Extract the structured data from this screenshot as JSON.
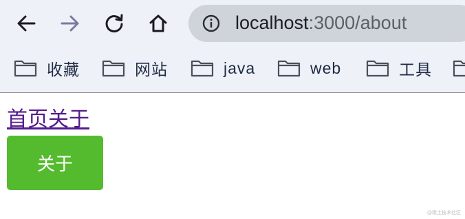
{
  "browser": {
    "url_host": "localhost",
    "url_path": ":3000/about",
    "bookmarks": [
      {
        "label": "收藏",
        "icon": "folder-icon"
      },
      {
        "label": "网站",
        "icon": "folder-icon"
      },
      {
        "label": "java",
        "icon": "folder-icon"
      },
      {
        "label": "web",
        "icon": "folder-icon"
      },
      {
        "label": "工具",
        "icon": "folder-icon"
      },
      {
        "label": "",
        "icon": "folder-icon"
      }
    ]
  },
  "page": {
    "nav_home": "首页",
    "nav_about": "关于",
    "button_label": "关于",
    "watermark": "@稀土技术社区"
  },
  "colors": {
    "link": "#551a8b",
    "button_bg": "#55bb2e",
    "chrome_bg": "#eef1f7",
    "omnibox_bg": "#cfd3da"
  }
}
